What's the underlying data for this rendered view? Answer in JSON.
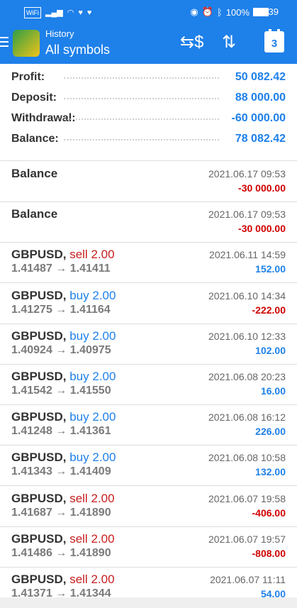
{
  "status_bar": {
    "carrier": "WiFi",
    "battery": "100%",
    "time": "06:39"
  },
  "header": {
    "title_small": "History",
    "title_big": "All symbols",
    "calendar_day": "3"
  },
  "summary": [
    {
      "label": "Profit:",
      "value": "50 082.42"
    },
    {
      "label": "Deposit:",
      "value": "88 000.00"
    },
    {
      "label": "Withdrawal:",
      "value": "-60 000.00"
    },
    {
      "label": "Balance:",
      "value": "78 082.42"
    }
  ],
  "records": [
    {
      "symbol": "Balance",
      "side": "",
      "volume": "",
      "open": "",
      "close": "",
      "date": "2021.06.17 09:53",
      "amount": "-30 000.00",
      "kind": "neg"
    },
    {
      "symbol": "Balance",
      "side": "",
      "volume": "",
      "open": "",
      "close": "",
      "date": "2021.06.17 09:53",
      "amount": "-30 000.00",
      "kind": "neg"
    },
    {
      "symbol": "GBPUSD,",
      "side": "sell",
      "volume": "2.00",
      "open": "1.41487",
      "close": "1.41411",
      "date": "2021.06.11 14:59",
      "amount": "152.00",
      "kind": "pos"
    },
    {
      "symbol": "GBPUSD,",
      "side": "buy",
      "volume": "2.00",
      "open": "1.41275",
      "close": "1.41164",
      "date": "2021.06.10 14:34",
      "amount": "-222.00",
      "kind": "neg"
    },
    {
      "symbol": "GBPUSD,",
      "side": "buy",
      "volume": "2.00",
      "open": "1.40924",
      "close": "1.40975",
      "date": "2021.06.10 12:33",
      "amount": "102.00",
      "kind": "pos"
    },
    {
      "symbol": "GBPUSD,",
      "side": "buy",
      "volume": "2.00",
      "open": "1.41542",
      "close": "1.41550",
      "date": "2021.06.08 20:23",
      "amount": "16.00",
      "kind": "pos"
    },
    {
      "symbol": "GBPUSD,",
      "side": "buy",
      "volume": "2.00",
      "open": "1.41248",
      "close": "1.41361",
      "date": "2021.06.08 16:12",
      "amount": "226.00",
      "kind": "pos"
    },
    {
      "symbol": "GBPUSD,",
      "side": "buy",
      "volume": "2.00",
      "open": "1.41343",
      "close": "1.41409",
      "date": "2021.06.08 10:58",
      "amount": "132.00",
      "kind": "pos"
    },
    {
      "symbol": "GBPUSD,",
      "side": "sell",
      "volume": "2.00",
      "open": "1.41687",
      "close": "1.41890",
      "date": "2021.06.07 19:58",
      "amount": "-406.00",
      "kind": "neg"
    },
    {
      "symbol": "GBPUSD,",
      "side": "sell",
      "volume": "2.00",
      "open": "1.41486",
      "close": "1.41890",
      "date": "2021.06.07 19:57",
      "amount": "-808.00",
      "kind": "neg"
    },
    {
      "symbol": "GBPUSD,",
      "side": "sell",
      "volume": "2.00",
      "open": "1.41371",
      "close": "1.41344",
      "date": "2021.06.07 11:11",
      "amount": "54.00",
      "kind": "pos"
    }
  ]
}
